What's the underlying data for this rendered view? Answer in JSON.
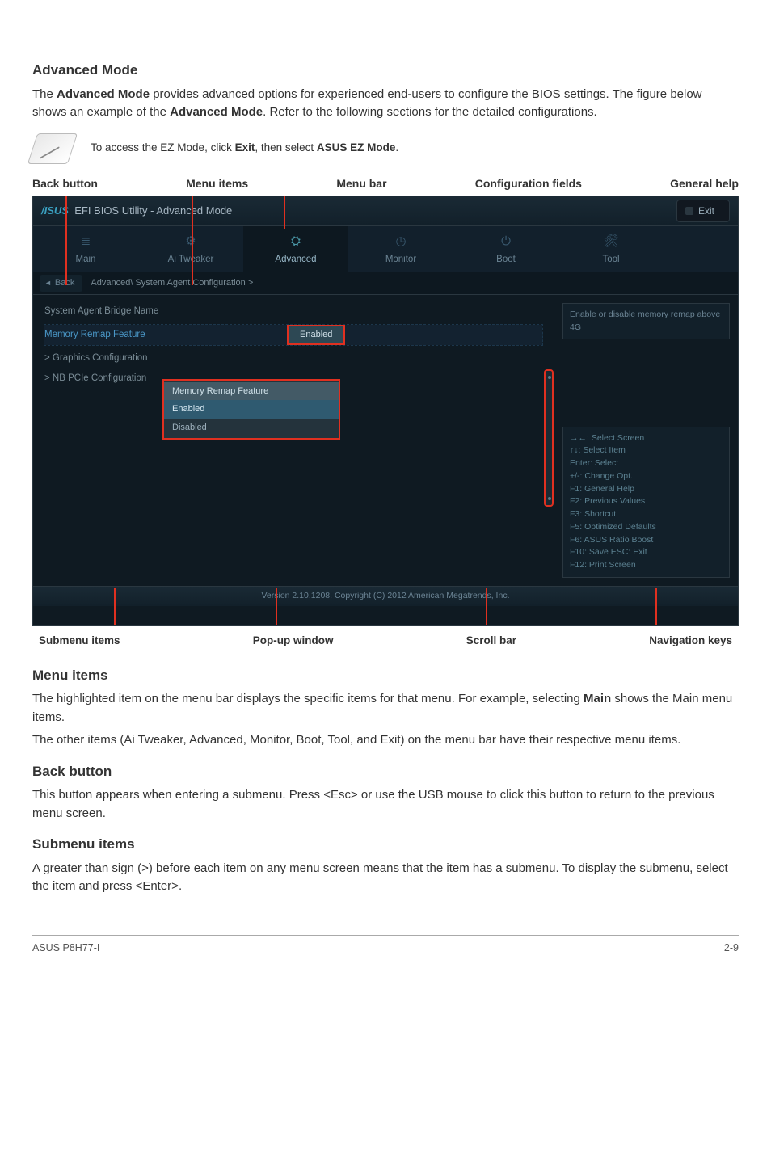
{
  "sections": {
    "advanced_mode_title": "Advanced Mode",
    "advanced_mode_body_1": "The ",
    "advanced_mode_body_bold": "Advanced Mode",
    "advanced_mode_body_2": " provides advanced options for experienced end-users to configure the BIOS settings. The figure below shows an example of the ",
    "advanced_mode_body_3": ". Refer to the following sections for the detailed configurations.",
    "note_pre": "To access the EZ Mode, click ",
    "note_b1": "Exit",
    "note_mid": ", then select ",
    "note_b2": "ASUS EZ Mode",
    "note_post": ".",
    "menu_items_title": "Menu items",
    "menu_items_body1": "The highlighted item on the menu bar displays the specific items for that menu. For example, selecting ",
    "menu_items_bold": "Main",
    "menu_items_body2": " shows the Main menu items.",
    "menu_items_body3": "The other items (Ai Tweaker, Advanced, Monitor, Boot, Tool, and Exit) on the menu bar have their respective menu items.",
    "back_btn_title": "Back button",
    "back_btn_body": "This button appears when entering a submenu. Press <Esc> or use the USB mouse to click this button to return to the previous menu screen.",
    "submenu_title": "Submenu items",
    "submenu_body": "A greater than sign (>) before each item on any menu screen means that the item has a submenu. To display the submenu, select the item and press <Enter>."
  },
  "annot_top": {
    "back": "Back button",
    "items": "Menu items",
    "bar": "Menu bar",
    "config": "Configuration fields",
    "help": "General help"
  },
  "annot_bottom": {
    "submenu": "Submenu items",
    "popup": "Pop-up window",
    "scroll": "Scroll bar",
    "nav": "Navigation keys"
  },
  "bios": {
    "title": "EFI BIOS Utility - Advanced Mode",
    "exit": "Exit",
    "tabs": [
      {
        "label": "Main",
        "icon": "≣"
      },
      {
        "label": "Ai Tweaker",
        "icon": "⚙"
      },
      {
        "label": "Advanced",
        "icon": "⛭",
        "active": true
      },
      {
        "label": "Monitor",
        "icon": "◷"
      },
      {
        "label": "Boot",
        "icon": "⏻"
      },
      {
        "label": "Tool",
        "icon": "🛠"
      }
    ],
    "crumb_back": "Back",
    "crumb_path": "Advanced\\ System Agent Configuration  >",
    "rows": {
      "r1_label": "System Agent Bridge Name",
      "r2_label": "Memory Remap Feature",
      "r2_value": "Enabled",
      "r3_label": "Graphics Configuration",
      "r4_label": "NB PCIe Configuration"
    },
    "popup": {
      "title": "Memory Remap Feature",
      "opt_sel": "Enabled",
      "opt2": "Disabled"
    },
    "help_text": "Enable or disable memory remap above 4G",
    "nav_keys": [
      "→←:  Select Screen",
      "↑↓:  Select Item",
      "Enter:  Select",
      "+/-:  Change Opt.",
      "F1:  General Help",
      "F2:  Previous Values",
      "F3:  Shortcut",
      "F5:  Optimized Defaults",
      "F6:  ASUS Ratio Boost",
      "F10:  Save   ESC:  Exit",
      "F12: Print Screen"
    ],
    "footer": "Version  2.10.1208.  Copyright (C)  2012 American  Megatrends,  Inc."
  },
  "footer": {
    "left": "ASUS P8H77-I",
    "right": "2-9"
  }
}
